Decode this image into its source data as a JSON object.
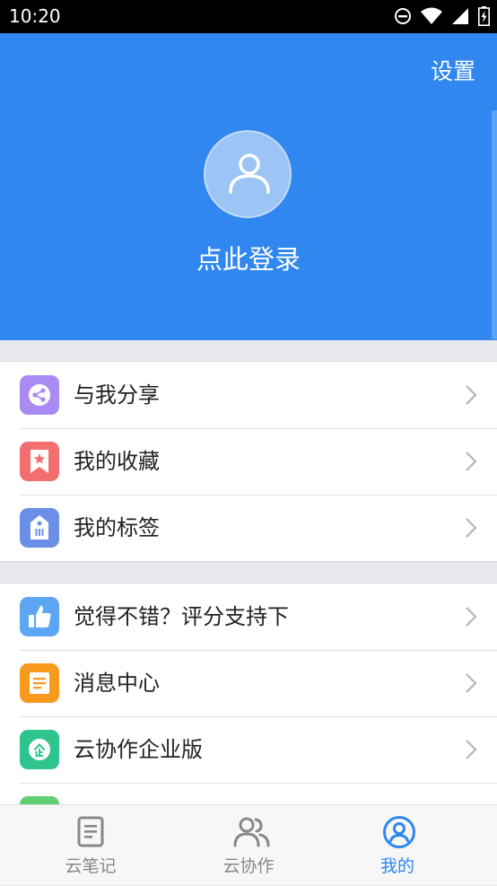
{
  "status_bar": {
    "time": "10:20",
    "icons": [
      "do-not-disturb-icon",
      "wifi-icon",
      "signal-icon",
      "battery-charging-icon"
    ]
  },
  "header": {
    "settings_label": "设置",
    "login_label": "点此登录",
    "background_color": "#2f87ef"
  },
  "menu_group_1": [
    {
      "label": "与我分享",
      "icon": "share-icon",
      "icon_color": "#a98cf3"
    },
    {
      "label": "我的收藏",
      "icon": "favorite-bookmark-icon",
      "icon_color": "#f26f6f"
    },
    {
      "label": "我的标签",
      "icon": "tag-icon",
      "icon_color": "#6b8fe6"
    }
  ],
  "menu_group_2": [
    {
      "label": "觉得不错？评分支持下",
      "icon": "thumbs-up-icon",
      "icon_color": "#5ca6f4"
    },
    {
      "label": "消息中心",
      "icon": "message-icon",
      "icon_color": "#f79a1e"
    },
    {
      "label": "云协作企业版",
      "icon": "enterprise-icon",
      "icon_color": "#2fc48d"
    },
    {
      "label": "",
      "icon": "partial-item-icon",
      "icon_color": "#5fcf72"
    }
  ],
  "tab_bar": {
    "tabs": [
      {
        "label": "云笔记",
        "icon": "note-icon",
        "active": false
      },
      {
        "label": "云协作",
        "icon": "collaboration-icon",
        "active": false
      },
      {
        "label": "我的",
        "icon": "profile-icon",
        "active": true
      }
    ],
    "active_color": "#2f87ef",
    "inactive_color": "#888888"
  }
}
